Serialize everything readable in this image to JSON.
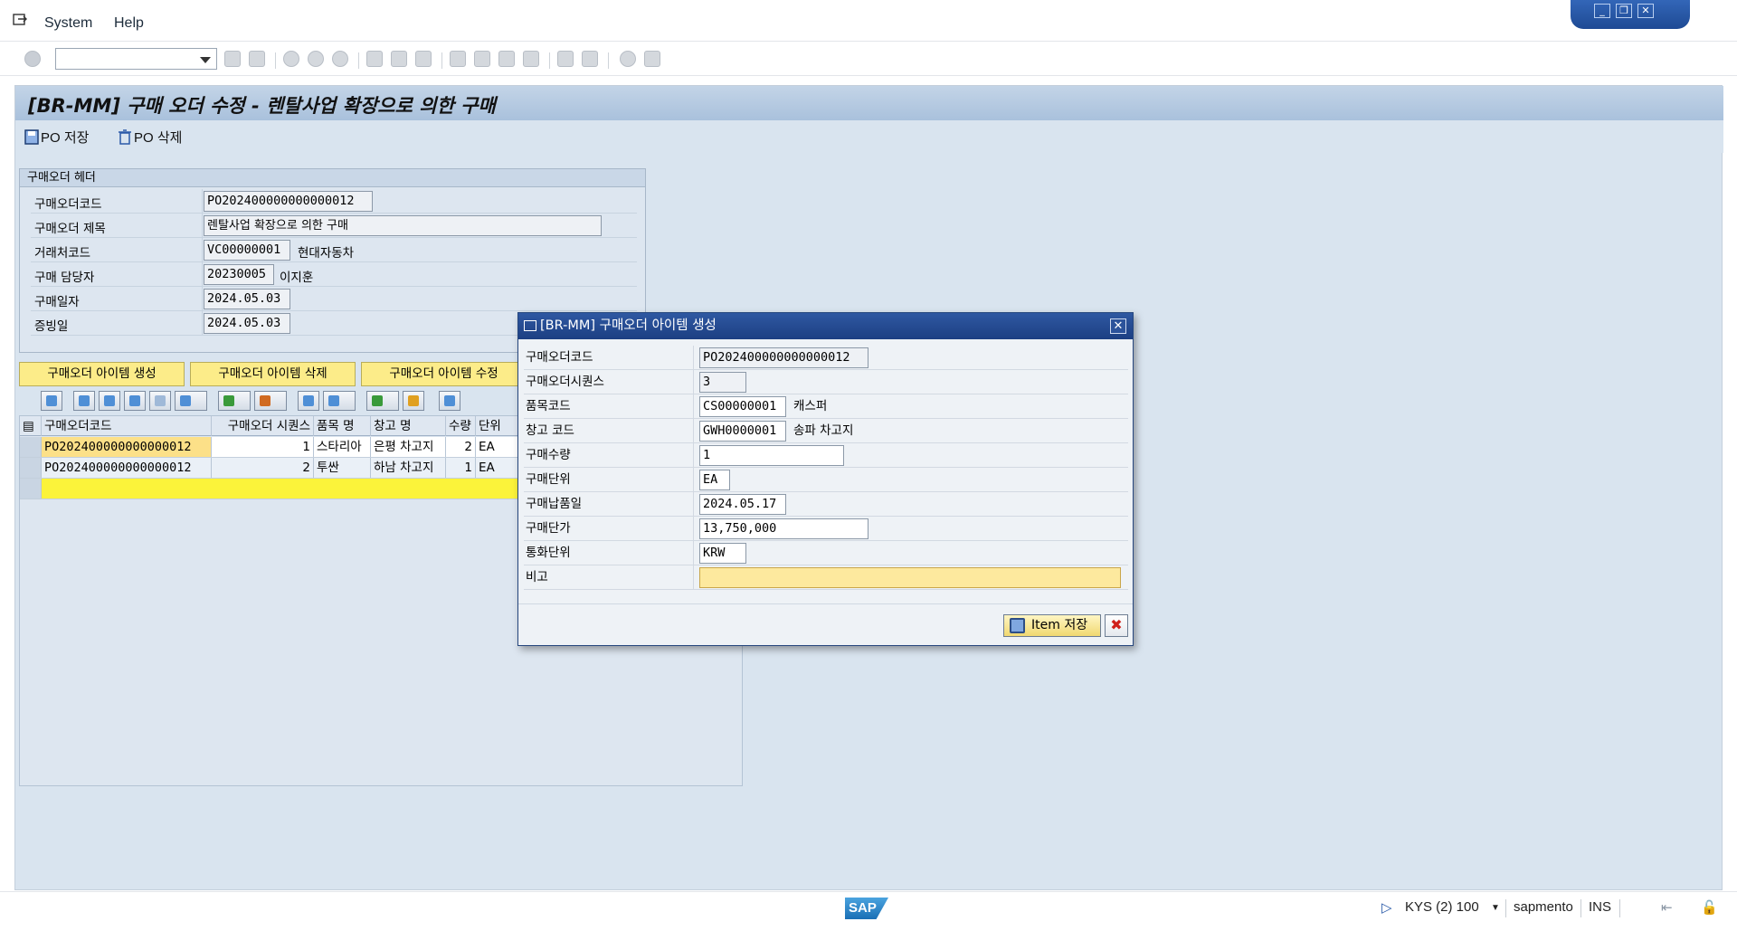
{
  "menu": {
    "system": "System",
    "help": "Help"
  },
  "toolbar": {
    "command_value": ""
  },
  "window": {
    "minimize": "_",
    "restore": "❐",
    "close": "✕"
  },
  "page": {
    "title": "[BR-MM] 구매 오더 수정 - 렌탈사업 확장으로 의한 구매",
    "po_save": "PO 저장",
    "po_delete": "PO 삭제"
  },
  "header_group": {
    "title": "구매오더 헤더",
    "fields": [
      {
        "label": "구매오더코드",
        "value": "PO202400000000000012",
        "desc": ""
      },
      {
        "label": "구매오더 제목",
        "value": "렌탈사업 확장으로 의한 구매",
        "desc": ""
      },
      {
        "label": "거래처코드",
        "value": "VC00000001",
        "desc": "현대자동차"
      },
      {
        "label": "구매 담당자",
        "value": "20230005",
        "desc": "이지훈"
      },
      {
        "label": "구매일자",
        "value": "2024.05.03",
        "desc": ""
      },
      {
        "label": "증빙일",
        "value": "2024.05.03",
        "desc": ""
      }
    ]
  },
  "item_buttons": {
    "create": "구매오더 아이템 생성",
    "delete": "구매오더 아이템 삭제",
    "modify": "구매오더 아이템 수정"
  },
  "grid": {
    "columns": [
      "구매오더코드",
      "구매오더 시퀀스",
      "품목 명",
      "창고 명",
      "수량",
      "단위"
    ],
    "rows": [
      [
        "PO202400000000000012",
        "1",
        "스타리아",
        "은평 차고지",
        "2",
        "EA"
      ],
      [
        "PO202400000000000012",
        "2",
        "투싼",
        "하남 차고지",
        "1",
        "EA"
      ]
    ]
  },
  "dialog": {
    "title": "[BR-MM] 구매오더 아이템 생성",
    "close": "✕",
    "fields": [
      {
        "label": "구매오더코드",
        "value": "PO202400000000000012",
        "desc": ""
      },
      {
        "label": "구매오더시퀀스",
        "value": "3",
        "desc": ""
      },
      {
        "label": "품목코드",
        "value": "CS00000001",
        "desc": "캐스퍼"
      },
      {
        "label": "창고 코드",
        "value": "GWH0000001",
        "desc": "송파 차고지"
      },
      {
        "label": "구매수량",
        "value": "1",
        "desc": ""
      },
      {
        "label": "구매단위",
        "value": "EA",
        "desc": ""
      },
      {
        "label": "구매납품일",
        "value": "2024.05.17",
        "desc": ""
      },
      {
        "label": "구매단가",
        "value": "13,750,000",
        "desc": ""
      },
      {
        "label": "통화단위",
        "value": "KRW",
        "desc": ""
      },
      {
        "label": "비고",
        "value": "",
        "desc": ""
      }
    ],
    "save_button": "Item 저장",
    "cancel_button": "✖"
  },
  "status": {
    "session": "KYS (2) 100",
    "server": "sapmento",
    "mode": "INS",
    "logo": "SAP"
  }
}
